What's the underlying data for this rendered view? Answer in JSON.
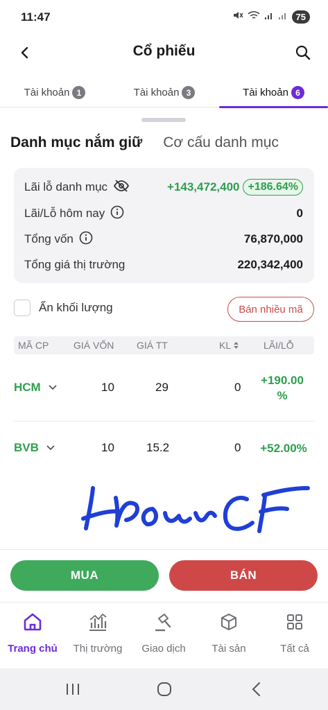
{
  "status_bar": {
    "time": "11:47",
    "battery": "75"
  },
  "header": {
    "title": "Cổ phiếu"
  },
  "account_tabs": [
    {
      "label": "Tài khoản",
      "badge": "1",
      "active": false
    },
    {
      "label": "Tài khoản",
      "badge": "3",
      "active": false
    },
    {
      "label": "Tài khoản",
      "badge": "6",
      "active": true
    }
  ],
  "section_tabs": {
    "holdings": "Danh mục nắm giữ",
    "structure": "Cơ cấu danh mục"
  },
  "summary": {
    "pnl_label": "Lãi lỗ danh mục",
    "pnl_value": "+143,472,400",
    "pnl_percent": "+186.64%",
    "today_label": "Lãi/Lỗ hôm nay",
    "today_value": "0",
    "capital_label": "Tổng vốn",
    "capital_value": "76,870,000",
    "market_label": "Tổng giá thị trường",
    "market_value": "220,342,400"
  },
  "controls": {
    "hide_qty_label": "Ẩn khối lượng",
    "sell_many_label": "Bán nhiều mã"
  },
  "table": {
    "headers": {
      "ticker": "MÃ CP",
      "cost": "GIÁ VỐN",
      "price": "GIÁ TT",
      "qty": "KL",
      "pnl": "LÃI/LỖ"
    },
    "rows": [
      {
        "ticker": "HCM",
        "cost": "10",
        "price": "29",
        "qty": "0",
        "pnl_line1": "+190.00",
        "pnl_line2": "%"
      },
      {
        "ticker": "BVB",
        "cost": "10",
        "price": "15.2",
        "qty": "0",
        "pnl_line1": "+52.00%",
        "pnl_line2": ""
      }
    ]
  },
  "actions": {
    "buy": "MUA",
    "sell": "BÁN"
  },
  "bottom_nav": [
    {
      "label": "Trang chủ",
      "icon": "home-icon",
      "active": true
    },
    {
      "label": "Thị trường",
      "icon": "market-chart-icon",
      "active": false
    },
    {
      "label": "Giao dịch",
      "icon": "gavel-icon",
      "active": false
    },
    {
      "label": "Tài sản",
      "icon": "cube-icon",
      "active": false
    },
    {
      "label": "Tất cả",
      "icon": "grid-icon",
      "active": false
    }
  ],
  "colors": {
    "accent": "#6c2bd9",
    "gain": "#2f9e4f",
    "buy": "#3faa5c",
    "sell": "#cf4848",
    "signature": "#1f3fd6"
  }
}
